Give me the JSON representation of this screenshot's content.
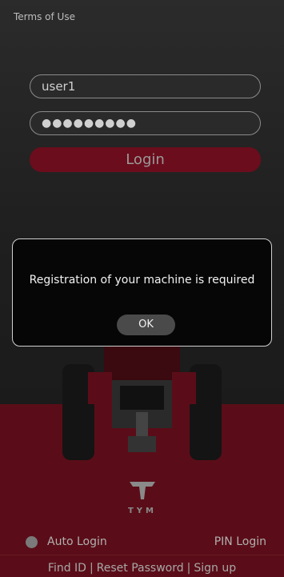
{
  "header": {
    "terms_link": "Terms of Use"
  },
  "login_form": {
    "username_value": "user1",
    "password_value": "●●●●●●●●●",
    "login_button": "Login"
  },
  "branding": {
    "logo_text": "TYM"
  },
  "options": {
    "auto_login_label": "Auto Login",
    "pin_login_label": "PIN Login"
  },
  "footer": {
    "find_id": "Find ID",
    "reset_password": "Reset Password",
    "sign_up": "Sign up",
    "separator": "|"
  },
  "dialog": {
    "message": "Registration of your machine is required",
    "ok_button": "OK"
  },
  "colors": {
    "accent": "#6b0d1c",
    "background": "#1e1e1e",
    "dialog_bg": "#060606"
  }
}
